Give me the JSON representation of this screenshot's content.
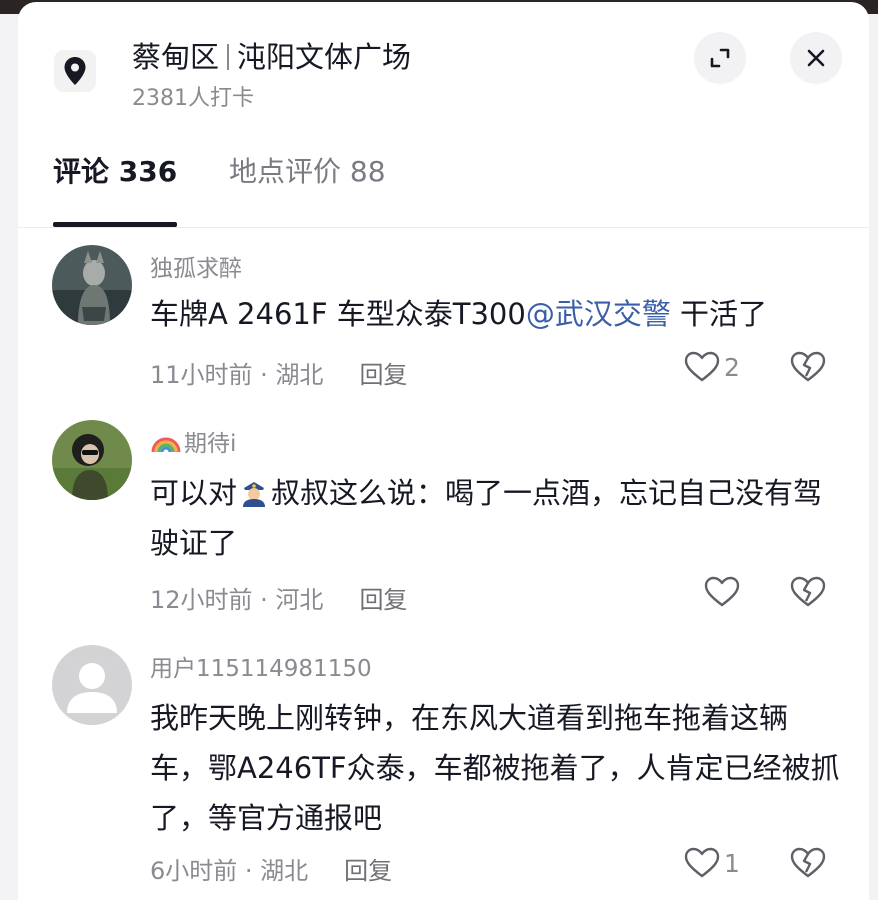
{
  "header": {
    "district": "蔡甸区",
    "place": "沌阳文体广场",
    "checkins": "2381人打卡",
    "icons": {
      "location": "location-pin-icon",
      "expand": "expand-icon",
      "close": "close-icon"
    }
  },
  "tabs": [
    {
      "label": "评论 336",
      "active": true
    },
    {
      "label": "地点评价 88",
      "active": false
    }
  ],
  "comments": [
    {
      "username": "独孤求醉",
      "text_before": "车牌A 2461F 车型众泰T300",
      "mention": "@武汉交警",
      "text_after": " 干活了",
      "time": "11小时前",
      "region": "湖北",
      "reply": "回复",
      "likes": "2"
    },
    {
      "username_prefix_icon": "rainbow-emoji",
      "username": "期待i",
      "text_before": "可以对",
      "emoji": "police-officer-emoji",
      "text_after": "叔叔这么说：喝了一点酒，忘记自己没有驾驶证了",
      "time": "12小时前",
      "region": "河北",
      "reply": "回复",
      "likes": ""
    },
    {
      "username": "用户115114981150",
      "text": "我昨天晚上刚转钟，在东风大道看到拖车拖着这辆车，鄂A246TF众泰，车都被拖着了，人肯定已经被抓了，等官方通报吧",
      "time": "6小时前",
      "region": "湖北",
      "reply": "回复",
      "likes": "1"
    }
  ],
  "meta_separator": " · ",
  "colors": {
    "text": "#161823",
    "muted": "#8a8b91",
    "mention": "#3b5ea8",
    "background": "#ffffff"
  }
}
